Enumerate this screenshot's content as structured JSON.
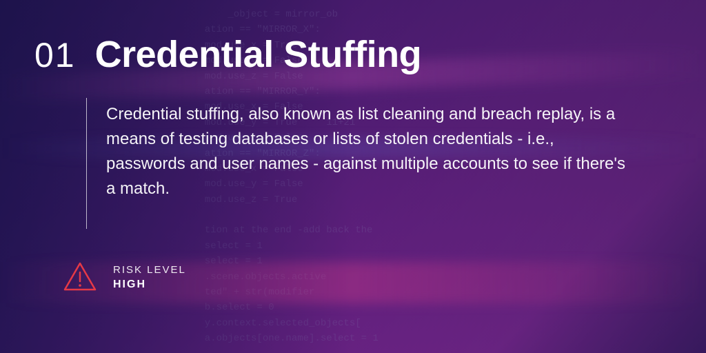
{
  "header": {
    "number": "01",
    "title": "Credential Stuffing"
  },
  "description": "Credential stuffing, also known as list cleaning and breach replay, is a means of testing databases or lists of stolen credentials - i.e., passwords and user names - against multiple accounts to see if there's a match.",
  "risk": {
    "label": "RISK LEVEL",
    "value": "HIGH",
    "icon_color": "#e63946"
  },
  "bg_code_text": "      _object = mirror_ob\n  ation == \"MIRROR_X\":\n  mod.use_x = True\n  mod.use_y = False\n  mod.use_z = False\n  ation == \"MIRROR_Y\":\n  mod.use_x = False\n  mod.use_y = True     11+21\n  mod.use_z = False\n  ation == \"MIRROR_Z\":\n  mod.use_x = False\n  mod.use_y = False\n  mod.use_z = True\n\n  tion at the end -add back the\n  select = 1\n  select = 1\n  .scene.objects.active\n  ted\" + str(modifier\n  b.select = 0\n  y.context.selected_objects[\n  a.objects[one.name].select = 1\n\n  (\"please select exactly two objects, \n\n  OPERATOR CLASSES\n\n\n\n  s.Operator):\n  mirror to the selected object"
}
